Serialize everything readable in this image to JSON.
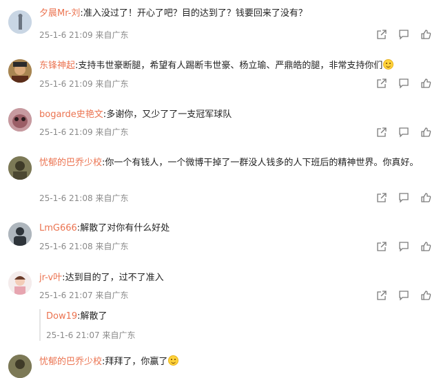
{
  "comments": [
    {
      "username": "夕晨Mr-刘",
      "separator": ":",
      "text": "准入没过了！开心了吧？目的达到了？钱要回来了没有？",
      "date": "25-1-6 21:09",
      "source": "来自广东"
    },
    {
      "username": "东锋神起",
      "separator": ":",
      "text": "支持韦世豪断腿，希望有人踢断韦世豪、杨立瑜、严鼎皓的腿，非常支持你们",
      "date": "25-1-6 21:09",
      "source": "来自广东"
    },
    {
      "username": "bogarde史艳文",
      "separator": ":",
      "text": "多谢你，又少了了一支冠军球队",
      "date": "25-1-6 21:09",
      "source": "来自广东"
    },
    {
      "username": "忧郁的巴乔少校",
      "separator": ":",
      "text": "你一个有钱人，一个微博干掉了一群没人钱多的人下班后的精神世界。你真好。",
      "date": "25-1-6 21:08",
      "source": "来自广东"
    },
    {
      "username": "LmG666",
      "separator": ":",
      "text": "解散了对你有什么好处",
      "date": "25-1-6 21:08",
      "source": "来自广东"
    },
    {
      "username": "jr-v叶",
      "separator": ":",
      "text": "达到目的了，过不了准入",
      "date": "25-1-6 21:07",
      "source": "来自广东"
    },
    {
      "username": "忧郁的巴乔少校",
      "separator": ":",
      "text": "拜拜了，你赢了",
      "date": "",
      "source": ""
    }
  ],
  "reply": {
    "username": "Dow19",
    "separator": ":",
    "text": "解散了",
    "date": "25-1-6 21:07",
    "source": "来自广东"
  },
  "icons": [
    "share-icon",
    "comment-icon",
    "like-icon"
  ],
  "colors": {
    "username": "#eb7350",
    "meta": "#8a8a8a",
    "text": "#222222"
  }
}
